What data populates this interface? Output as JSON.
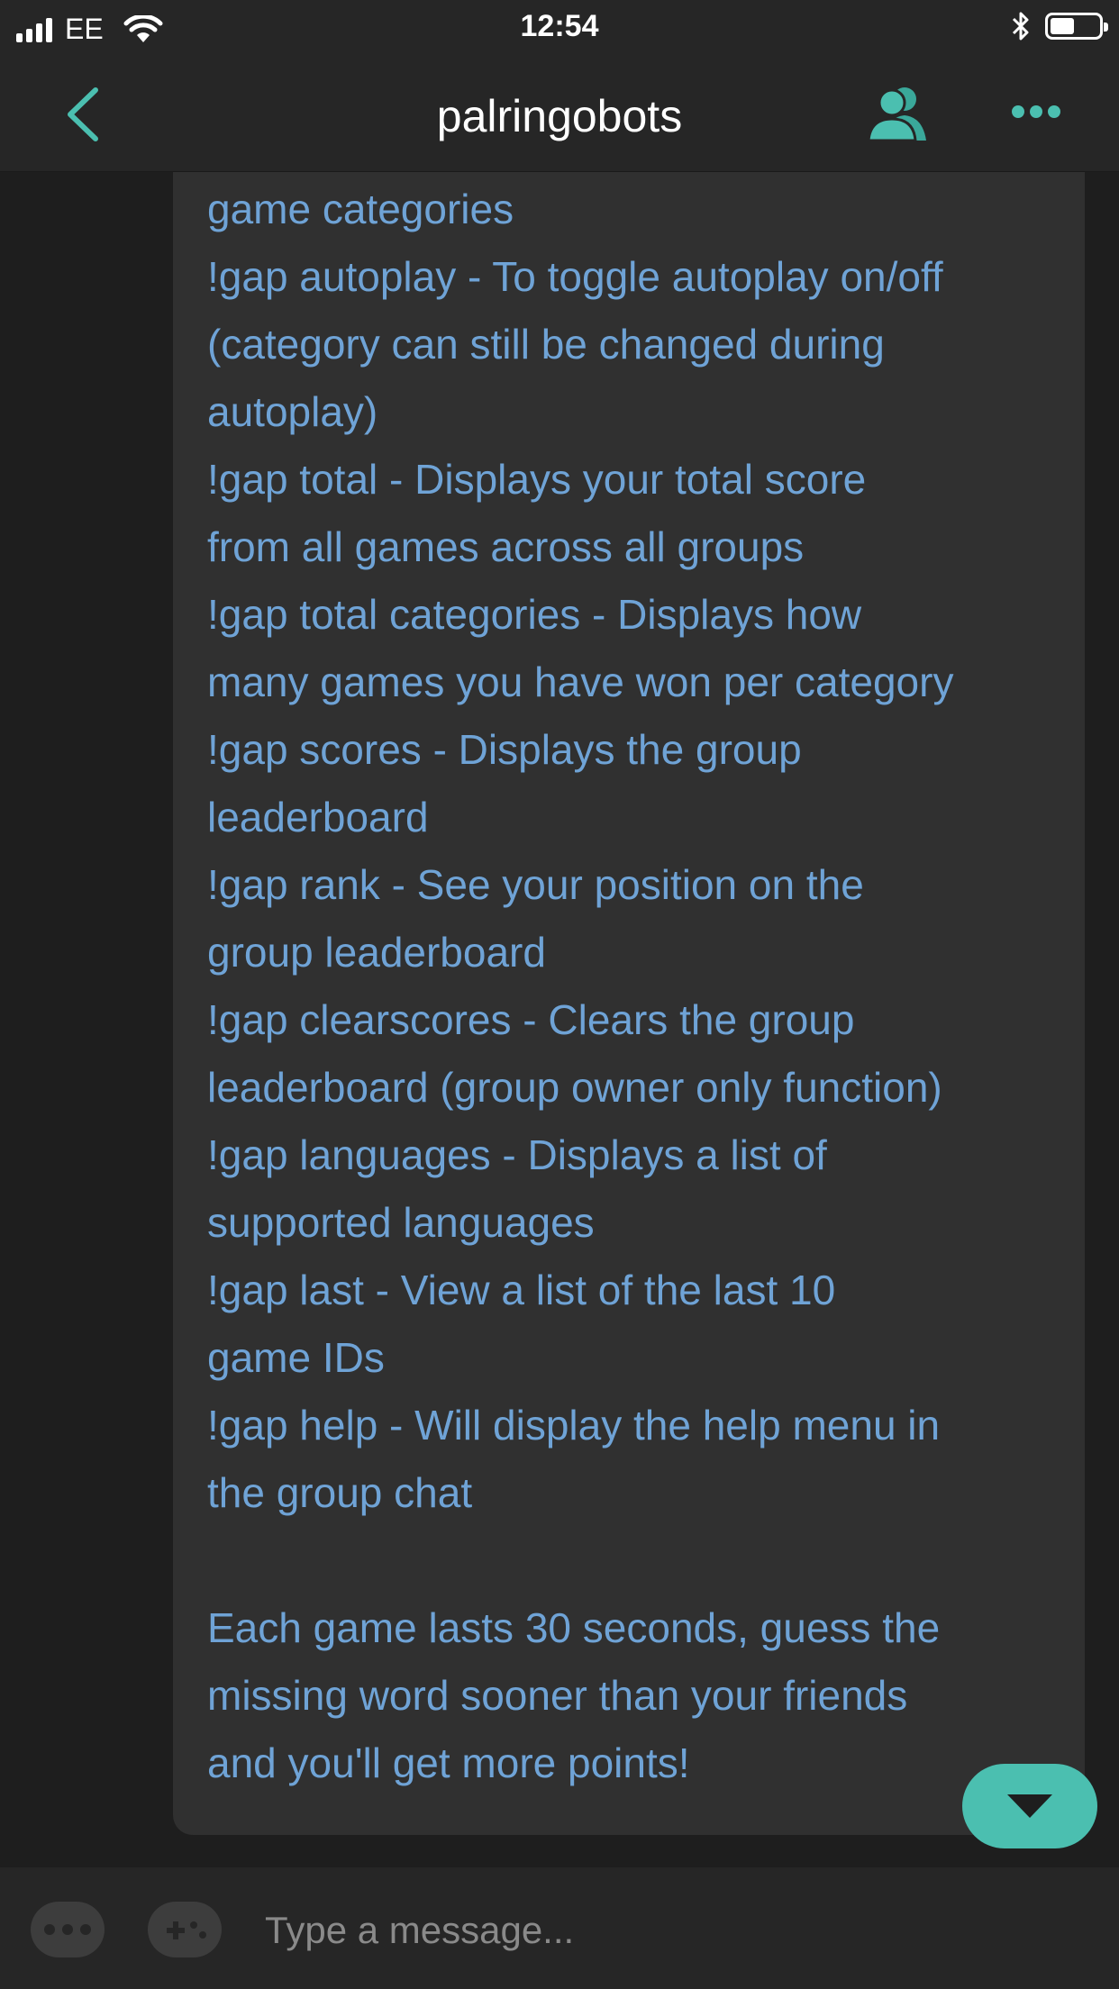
{
  "status_bar": {
    "carrier": "EE",
    "time": "12:54",
    "battery_level": 0.5
  },
  "header": {
    "title": "palringobots",
    "icons": {
      "back": "chevron-left-icon",
      "members": "group-members-icon",
      "more": "more-dots-icon"
    }
  },
  "message": {
    "text": "!gap categories - A list of all\ngame categories\n!gap autoplay - To toggle autoplay on/off\n(category can still be changed during\nautoplay)\n!gap total - Displays your total score\nfrom all games across all groups\n!gap total categories - Displays how\nmany games you have won per category\n!gap scores - Displays the group\nleaderboard\n!gap rank - See your position on the\ngroup leaderboard\n!gap clearscores - Clears the group\nleaderboard (group owner only function)\n!gap languages - Displays a list of\nsupported languages\n!gap last - View a list of the last 10\ngame IDs\n!gap help - Will display the help menu in\nthe group chat\n\nEach game lasts 30 seconds, guess the\nmissing word sooner than your friends\nand you'll get more points!"
  },
  "composer": {
    "placeholder": "Type a message..."
  },
  "colors": {
    "accent": "#4bbfb0",
    "message_text": "#6fa3d6",
    "bubble": "#303030",
    "background": "#1e1e1e",
    "bar": "#262626"
  }
}
